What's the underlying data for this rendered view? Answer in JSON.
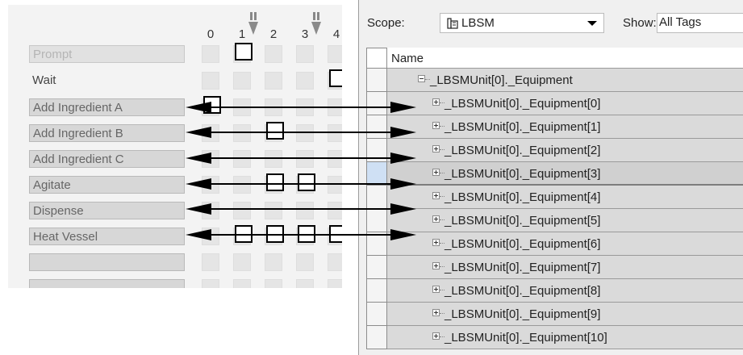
{
  "step_grid": {
    "column_numbers": [
      "0",
      "1",
      "2",
      "3",
      "4"
    ],
    "steps": [
      {
        "label": "Prompt",
        "style": "prompt"
      },
      {
        "label": "Wait",
        "style": "plain"
      },
      {
        "label": "Add Ingredient A",
        "style": "boxed"
      },
      {
        "label": "Add Ingredient B",
        "style": "boxed"
      },
      {
        "label": "Add Ingredient C",
        "style": "boxed"
      },
      {
        "label": "Agitate",
        "style": "boxed"
      },
      {
        "label": "Dispense",
        "style": "boxed"
      },
      {
        "label": "Heat Vessel",
        "style": "boxed"
      },
      {
        "label": "",
        "style": "boxed"
      },
      {
        "label": "",
        "style": "boxed"
      }
    ]
  },
  "tag_browser": {
    "scope_label": "Scope:",
    "scope_value": "LBSM",
    "scope_icon": "controller-icon",
    "show_label": "Show:",
    "show_value": "All Tags",
    "column_header": "Name",
    "parent_tag": "_LBSMUnit[0]._Equipment",
    "tags": [
      "_LBSMUnit[0]._Equipment[0]",
      "_LBSMUnit[0]._Equipment[1]",
      "_LBSMUnit[0]._Equipment[2]",
      "_LBSMUnit[0]._Equipment[3]",
      "_LBSMUnit[0]._Equipment[4]",
      "_LBSMUnit[0]._Equipment[5]",
      "_LBSMUnit[0]._Equipment[6]",
      "_LBSMUnit[0]._Equipment[7]",
      "_LBSMUnit[0]._Equipment[8]",
      "_LBSMUnit[0]._Equipment[9]",
      "_LBSMUnit[0]._Equipment[10]"
    ]
  },
  "colors": {
    "selection_blue": "#cfe0f4",
    "arrow": "#000000"
  }
}
